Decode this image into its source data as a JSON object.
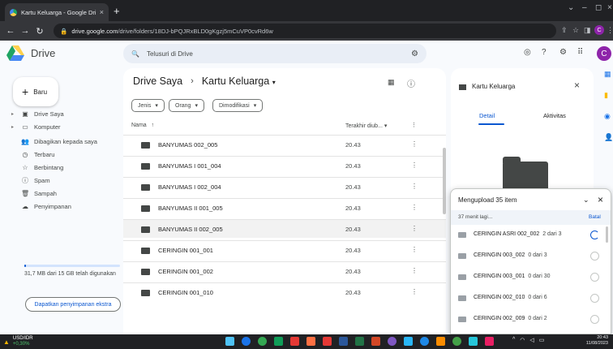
{
  "browser": {
    "tab_title": "Kartu Keluarga - Google Drive",
    "tab_close": "×",
    "new_tab": "+",
    "url_host": "drive.google.com",
    "url_path": "/drive/folders/18DJ-bPQJRxBLD0gKgzj5mCuVP0cvRd6w",
    "profile_letter": "C"
  },
  "header": {
    "app_name": "Drive",
    "search_placeholder": "Telusuri di Drive",
    "avatar_letter": "C"
  },
  "sidebar": {
    "new_label": "Baru",
    "items": [
      {
        "label": "Drive Saya",
        "icon": "my-drive-icon",
        "glyph": "▣",
        "arrow": "▸"
      },
      {
        "label": "Komputer",
        "icon": "computer-icon",
        "glyph": "▭",
        "arrow": "▸"
      },
      {
        "label": "Dibagikan kepada saya",
        "icon": "shared-icon",
        "glyph": "👥",
        "arrow": ""
      },
      {
        "label": "Terbaru",
        "icon": "clock-icon",
        "glyph": "◷",
        "arrow": ""
      },
      {
        "label": "Berbintang",
        "icon": "star-icon",
        "glyph": "☆",
        "arrow": ""
      },
      {
        "label": "Spam",
        "icon": "spam-icon",
        "glyph": "ⓘ",
        "arrow": ""
      },
      {
        "label": "Sampah",
        "icon": "trash-icon",
        "glyph": "🗑",
        "arrow": ""
      },
      {
        "label": "Penyimpanan",
        "icon": "cloud-icon",
        "glyph": "☁",
        "arrow": ""
      }
    ],
    "storage_text": "31,7 MB dari 15 GB telah digunakan",
    "storage_fraction": 0.002,
    "get_storage": "Dapatkan penyimpanan ekstra"
  },
  "main": {
    "breadcrumb_root": "Drive Saya",
    "breadcrumb_sep": "›",
    "breadcrumb_current": "Kartu Keluarga",
    "filters": [
      "Jenis",
      "Orang",
      "Dimodifikasi"
    ],
    "col_name": "Nama",
    "col_modified": "Terakhir diub...",
    "rows": [
      {
        "name": "BANYUMAS 002_005",
        "time": "20.43"
      },
      {
        "name": "BANYUMAS I 001_004",
        "time": "20.43"
      },
      {
        "name": "BANYUMAS I 002_004",
        "time": "20.43"
      },
      {
        "name": "BANYUMAS II 001_005",
        "time": "20.43"
      },
      {
        "name": "BANYUMAS II 002_005",
        "time": "20.43"
      },
      {
        "name": "CERINGIN 001_001",
        "time": "20.43"
      },
      {
        "name": "CERINGIN 001_002",
        "time": "20.43"
      },
      {
        "name": "CERINGIN 001_010",
        "time": "20.43"
      }
    ]
  },
  "details": {
    "title": "Kartu Keluarga",
    "tab_detail": "Detail",
    "tab_activity": "Aktivitas"
  },
  "upload": {
    "title": "Mengupload 35 item",
    "time_left": "37 menit lagi...",
    "cancel": "Batal",
    "items": [
      {
        "name": "CERINGIN ASRI 002_002",
        "progress": "2 dari 3",
        "active": true
      },
      {
        "name": "CERINGIN 003_002",
        "progress": "0 dari 3",
        "active": false
      },
      {
        "name": "CERINGIN 003_001",
        "progress": "0 dari 30",
        "active": false
      },
      {
        "name": "CERINGIN 002_010",
        "progress": "0 dari 6",
        "active": false
      },
      {
        "name": "CERINGIN 002_009",
        "progress": "0 dari 2",
        "active": false
      }
    ]
  },
  "taskbar": {
    "stock_name": "USD/IDR",
    "stock_change": "+0,30%",
    "time": "20:43",
    "date": "11/08/2023"
  },
  "colors": {
    "accent": "#0b57d0",
    "avatar": "#8e24aa",
    "drive_green": "#1fa463",
    "drive_yellow": "#ffd04b",
    "drive_blue": "#4688f4"
  }
}
